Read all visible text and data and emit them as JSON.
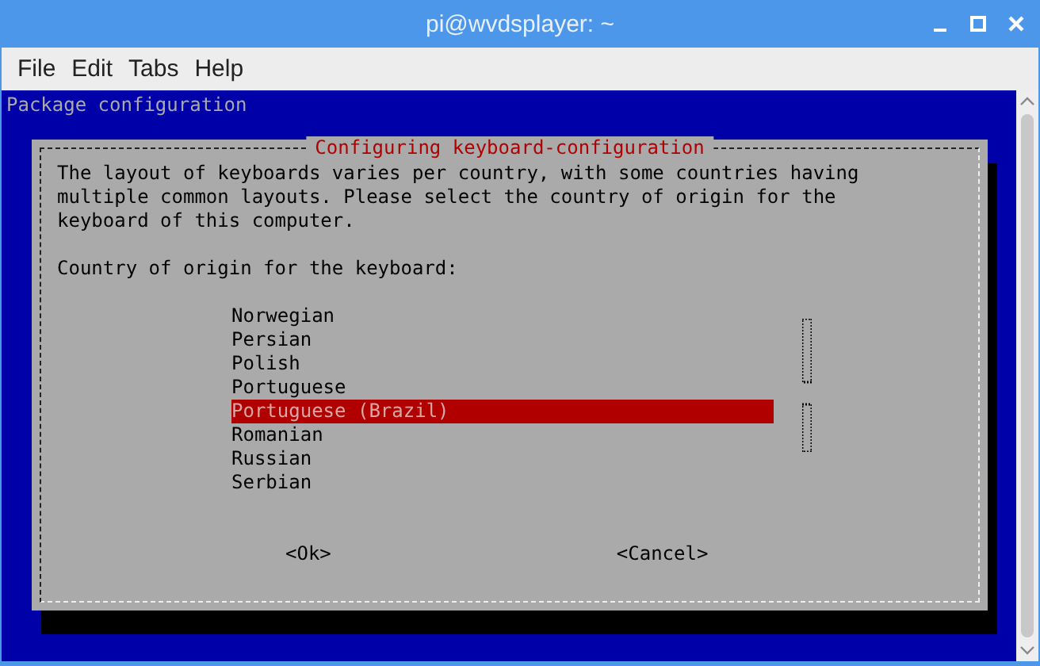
{
  "window": {
    "title": "pi@wvdsplayer: ~"
  },
  "menu": [
    "File",
    "Edit",
    "Tabs",
    "Help"
  ],
  "terminal": {
    "header": "Package configuration"
  },
  "dialog": {
    "title": "Configuring keyboard-configuration",
    "message": "The layout of keyboards varies per country, with some countries having\nmultiple common layouts. Please select the country of origin for the\nkeyboard of this computer.",
    "prompt": "Country of origin for the keyboard:",
    "options": [
      {
        "label": "Norwegian",
        "selected": false
      },
      {
        "label": "Persian",
        "selected": false
      },
      {
        "label": "Polish",
        "selected": false
      },
      {
        "label": "Portuguese",
        "selected": false
      },
      {
        "label": "Portuguese (Brazil)",
        "selected": true
      },
      {
        "label": "Romanian",
        "selected": false
      },
      {
        "label": "Russian",
        "selected": false
      },
      {
        "label": "Serbian",
        "selected": false
      }
    ],
    "buttons": [
      "<Ok>",
      "<Cancel>"
    ]
  }
}
